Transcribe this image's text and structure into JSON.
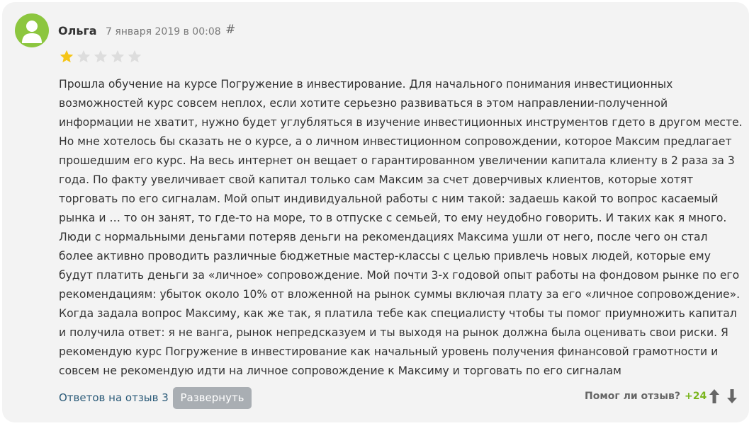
{
  "review": {
    "author": "Ольга",
    "date": "7 января 2019 в 00:08",
    "permalink_symbol": "#",
    "rating": 1,
    "rating_max": 5,
    "text": "Прошла обучение на курсе Погружение в инвестирование. Для начального понимания инвестиционных возможностей курс совсем неплох, если хотите серьезно развиваться в этом направлении-полученной информации не хватит, нужно будет углубляться в изучение инвестиционных инструментов гдето в другом месте. Но мне хотелось бы сказать не о курсе, а о личном инвестиционном сопровождении, которое Максим предлагает прошедшим его курс. На весь интернет он вещает о гарантированном увеличении капитала клиенту в 2 раза за 3 года. По факту увеличивает свой капитал только сам Максим за счет доверчивых клиентов, которые хотят торговать по его сигналам. Мой опыт индивидуальной работы с ним такой: задаешь какой то вопрос касаемый рынка и … то он занят, то где-то на море, то в отпуске с семьей, то ему неудобно говорить. И таких как я много. Люди с нормальными деньгами потеряв деньги на рекомендациях Максима ушли от него, после чего он стал более активно проводить различные бюджетные мастер-классы с целью привлечь новых людей, которые ему будут платить деньги за «личное» сопровождение. Мой почти 3-х годовой опыт работы на фондовом рынке по его рекомендациям: убыток около 10% от вложенной на рынок суммы включая плату за его «личное сопровождение». Когда задала вопрос Максиму, как же так, я платила тебе как специалисту чтобы ты помог приумножить капитал и получила ответ: я не ванга, рынок непредсказуем и ты выходя на рынок должна была оценивать свои риски. Я рекомендую курс Погружение в инвестирование как начальный уровень получения финансовой грамотности и совсем не рекомендую идти на личное сопровождение к Максиму и торговать по его сигналам",
    "replies_label": "Ответов на отзыв 3",
    "expand_label": "Развернуть",
    "helpful_label": "Помог ли отзыв?",
    "score": "+24"
  },
  "colors": {
    "avatar_bg": "#8cc63f",
    "star_filled": "#f5c518",
    "star_empty": "#dddddd",
    "score": "#7ab51d",
    "link": "#2a5a78",
    "button_bg": "#a9aeb3"
  },
  "icons": {
    "avatar": "user-silhouette-icon",
    "upvote": "arrow-up-icon",
    "downvote": "arrow-down-icon",
    "star": "star-icon"
  }
}
